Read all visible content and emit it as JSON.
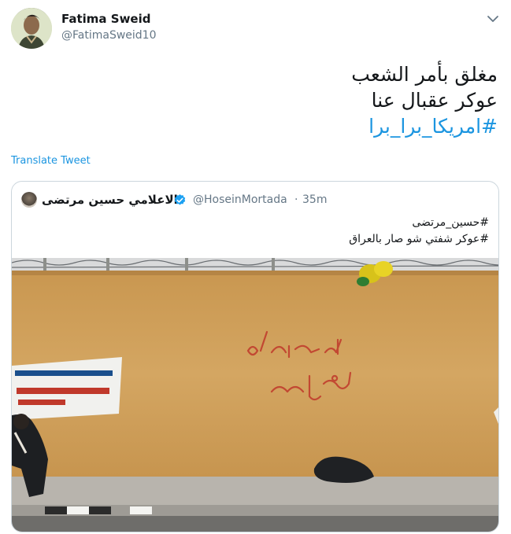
{
  "author": {
    "name": "Fatima Sweid",
    "handle": "@FatimaSweid10"
  },
  "tweet": {
    "lines": [
      "مغلق بأمر الشعب",
      "عوكر عقبال عنا",
      "#امريكا_برا_برا"
    ]
  },
  "translate_label": "Translate Tweet",
  "quoted": {
    "name": "الاعلامي حسين مرتضى",
    "handle": "@HoseinMortada",
    "separator": "·",
    "time": "35m",
    "lines": [
      "#حسين_مرتضى",
      "#عوكر شفتي شو صار بالعراق"
    ],
    "image": {
      "wall_writing": [
        "مغلقة بأمر",
        "الشعب"
      ]
    }
  },
  "colors": {
    "link": "#1b95e0",
    "secondary_text": "#657786",
    "verified": "#1da1f2",
    "wall": "#d2a45c",
    "graffiti": "#c0392b"
  },
  "icons": {
    "caret": "chevron-down-icon",
    "verified": "verified-badge-icon"
  }
}
